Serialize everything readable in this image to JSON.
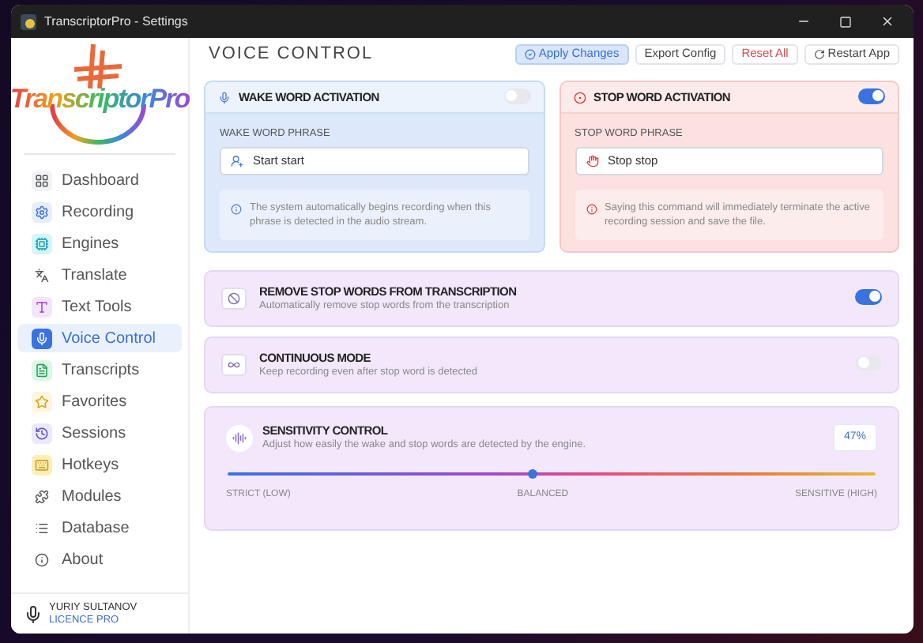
{
  "window": {
    "title": "TranscriptorPro - Settings"
  },
  "logo": {
    "text": "TranscriptorPro"
  },
  "sidebar": {
    "items": [
      {
        "label": "Dashboard",
        "selected": false
      },
      {
        "label": "Recording",
        "selected": false
      },
      {
        "label": "Engines",
        "selected": false
      },
      {
        "label": "Translate",
        "selected": false
      },
      {
        "label": "Text Tools",
        "selected": false
      },
      {
        "label": "Voice Control",
        "selected": true
      },
      {
        "label": "Transcripts",
        "selected": false
      },
      {
        "label": "Favorites",
        "selected": false
      },
      {
        "label": "Sessions",
        "selected": false
      },
      {
        "label": "Hotkeys",
        "selected": false
      },
      {
        "label": "Modules",
        "selected": false
      },
      {
        "label": "Database",
        "selected": false
      },
      {
        "label": "About",
        "selected": false
      }
    ]
  },
  "user": {
    "name": "YURIY SULTANOV",
    "licence": "LICENCE PRO"
  },
  "page_title": "VOICE CONTROL",
  "actions": [
    {
      "label": "Apply Changes",
      "kind": "primary"
    },
    {
      "label": "Export Config",
      "kind": "plain"
    },
    {
      "label": "Reset All",
      "kind": "danger"
    },
    {
      "label": "Restart App",
      "kind": "restart"
    }
  ],
  "activation_cards": [
    {
      "kind": "wake",
      "title": "WAKE WORD ACTIVATION",
      "on": false,
      "field_label": "WAKE WORD PHRASE",
      "value": "Start start",
      "note": "The system automatically begins recording when this phrase is detected in the audio stream."
    },
    {
      "kind": "stop",
      "title": "STOP WORD ACTIVATION",
      "on": true,
      "field_label": "STOP WORD PHRASE",
      "value": "Stop stop",
      "note": "Saying this command will immediately terminate the active recording session and save the file."
    }
  ],
  "options": [
    {
      "kind": "remove",
      "title": "REMOVE STOP WORDS FROM TRANSCRIPTION",
      "description": "Automatically remove stop words from the transcription",
      "on": true
    },
    {
      "kind": "continuous",
      "title": "CONTINUOUS MODE",
      "description": "Keep recording even after stop word is detected",
      "on": false
    }
  ],
  "sensitivity": {
    "title": "SENSITIVITY CONTROL",
    "description": "Adjust how easily the wake and stop words are detected by the engine.",
    "reading": "47%",
    "level": 0.47,
    "labels": [
      "STRICT (LOW)",
      "BALANCED",
      "SENSITIVE (HIGH)"
    ]
  }
}
